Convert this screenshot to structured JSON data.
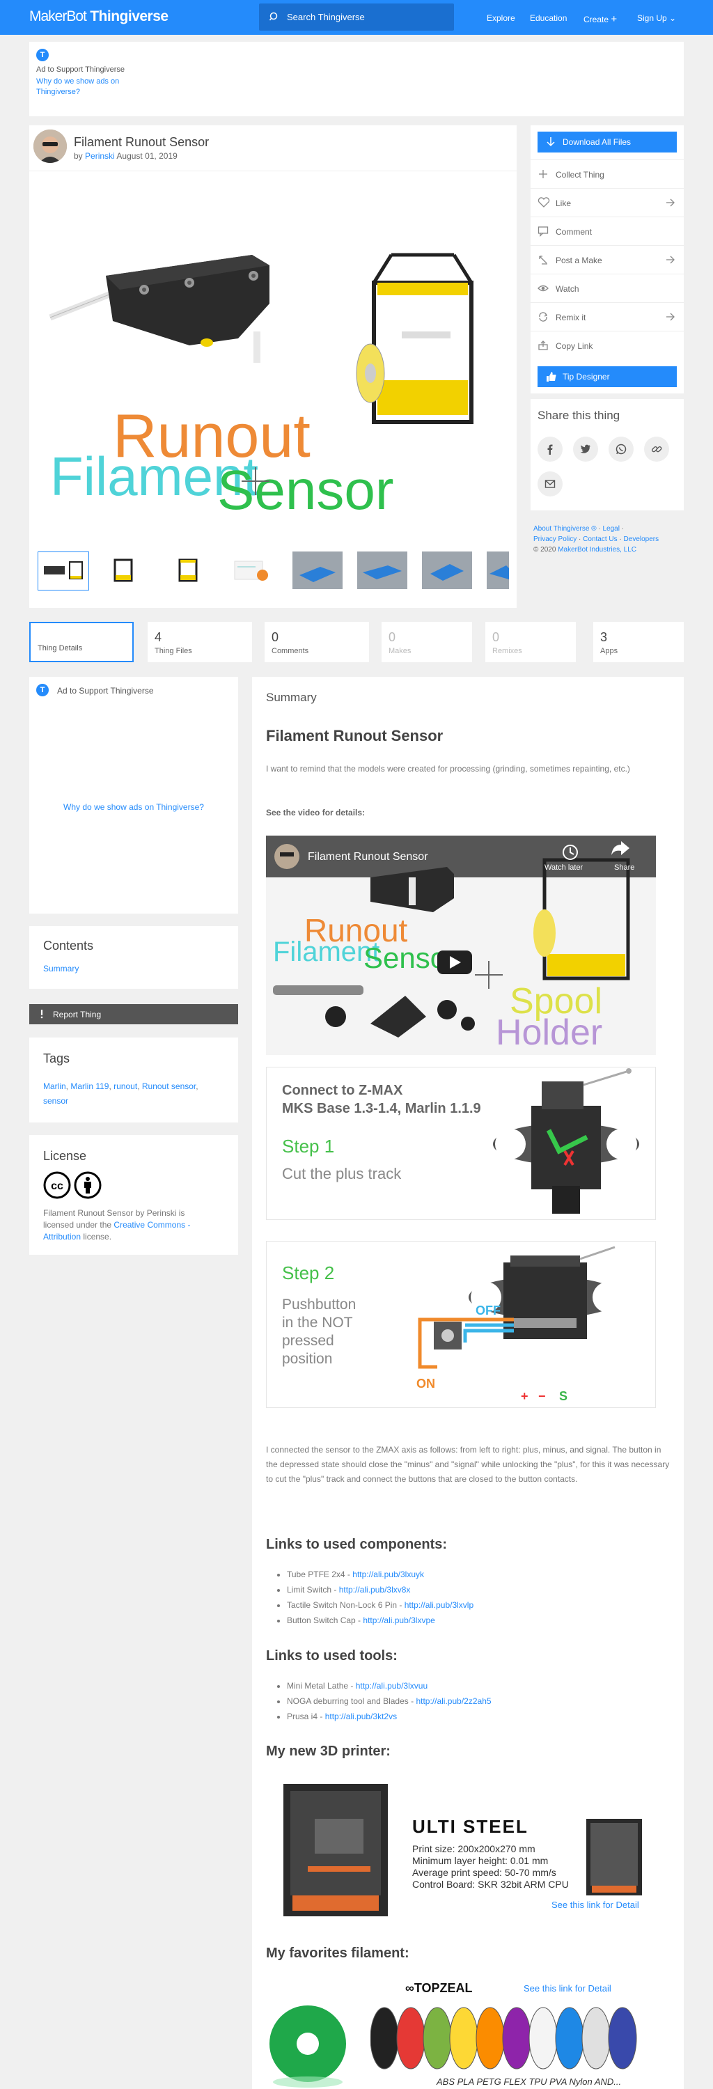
{
  "header": {
    "logo_maker": "MakerBot",
    "logo_thing": "Thingiverse",
    "search_placeholder": "Search Thingiverse",
    "nav": [
      "Explore",
      "Education",
      "Create",
      "Sign Up"
    ],
    "brand_color": "#248bfb"
  },
  "adbar": {
    "badge": "T",
    "support": "Ad to Support Thingiverse",
    "why": "Why do we show ads on Thingiverse?"
  },
  "thing": {
    "title": "Filament Runout Sensor",
    "by": "by",
    "author": "Perinski",
    "date": "August 01, 2019",
    "hero_words": [
      "Runout",
      "Filament",
      "Sensor"
    ],
    "thumb_count": 8
  },
  "actions": {
    "download": "Download All Files",
    "items": [
      {
        "label": "Collect Thing",
        "icon": "plus-icon",
        "arrow": false
      },
      {
        "label": "Like",
        "icon": "heart-icon",
        "arrow": true
      },
      {
        "label": "Comment",
        "icon": "comment-icon",
        "arrow": false
      },
      {
        "label": "Post a Make",
        "icon": "make-icon",
        "arrow": true
      },
      {
        "label": "Watch",
        "icon": "eye-icon",
        "arrow": false
      },
      {
        "label": "Remix it",
        "icon": "remix-icon",
        "arrow": true
      },
      {
        "label": "Copy Link",
        "icon": "share-icon",
        "arrow": false
      }
    ],
    "tip": "Tip Designer"
  },
  "share": {
    "title": "Share this thing",
    "networks": [
      "facebook-icon",
      "twitter-icon",
      "whatsapp-icon",
      "link-icon",
      "email-icon"
    ]
  },
  "footer": {
    "about": "About Thingiverse ®",
    "legal": "Legal",
    "privacy": "Privacy Policy",
    "contact": "Contact Us",
    "developers": "Developers",
    "copyright": "© 2020",
    "company": "MakerBot Industries, LLC"
  },
  "tabs": [
    {
      "num": "",
      "label": "Thing Details",
      "muted": false
    },
    {
      "num": "4",
      "label": "Thing Files",
      "muted": false
    },
    {
      "num": "0",
      "label": "Comments",
      "muted": false
    },
    {
      "num": "0",
      "label": "Makes",
      "muted": true
    },
    {
      "num": "0",
      "label": "Remixes",
      "muted": true
    },
    {
      "num": "3",
      "label": "Apps",
      "muted": false
    }
  ],
  "ad2": {
    "badge": "T",
    "support": "Ad to Support Thingiverse",
    "why": "Why do we show ads on Thingiverse?"
  },
  "contents": {
    "title": "Contents",
    "link": "Summary"
  },
  "report": "Report Thing",
  "tags": {
    "title": "Tags",
    "items": [
      "Marlin",
      "Marlin 119",
      "runout",
      "Runout sensor",
      "sensor"
    ]
  },
  "license": {
    "title": "License",
    "text_a": "Filament Runout Sensor by Perinski is licensed under the",
    "link": "Creative Commons - Attribution",
    "text_b": "license."
  },
  "summary": {
    "section": "Summary",
    "heading": "Filament Runout Sensor",
    "intro": "I want to remind that the models were created for processing (grinding, sometimes repainting, etc.)",
    "video_label": "See the video for details:",
    "video_title": "Filament Runout Sensor",
    "video_watch": "Watch later",
    "video_share": "Share",
    "video_words": [
      "Runout",
      "Filament",
      "Sensor",
      "Spool",
      "Holder"
    ],
    "step1_line1": "Connect to Z-MAX",
    "step1_line2": "MKS Base 1.3-1.4, Marlin 1.1.9",
    "step1_title": "Step 1",
    "step1_desc": "Cut the plus track",
    "step2_title": "Step 2",
    "step2_desc": [
      "Pushbutton",
      "in the NOT",
      "pressed",
      "position"
    ],
    "step2_off": "OFF",
    "step2_on": "ON",
    "step2_signs": [
      "+",
      "−",
      "S"
    ],
    "body": "I connected the sensor to the ZMAX axis as follows: from left to right: plus, minus, and signal. The button in the depressed state should close the \"minus\" and \"signal\" while unlocking the \"plus\", for this it was necessary to cut the \"plus\" track and connect the buttons that are closed to the button contacts.",
    "components_title": "Links to used components:",
    "components": [
      {
        "name": "Tube PTFE 2x4",
        "url": "http://ali.pub/3lxuyk"
      },
      {
        "name": "Limit Switch",
        "url": "http://ali.pub/3lxv8x"
      },
      {
        "name": "Tactile Switch Non-Lock 6 Pin",
        "url": "http://ali.pub/3lxvlp"
      },
      {
        "name": "Button Switch Cap",
        "url": "http://ali.pub/3lxvpe"
      }
    ],
    "tools_title": "Links to used tools:",
    "tools": [
      {
        "name": "Mini Metal Lathe",
        "url": "http://ali.pub/3lxvuu"
      },
      {
        "name": "NOGA deburring tool and Blades",
        "url": "http://ali.pub/2z2ah5"
      },
      {
        "name": "Prusa i4",
        "url": "http://ali.pub/3kt2vs"
      }
    ],
    "printer_title": "My new 3D printer:",
    "printer_name": "ULTI STEEL",
    "printer_specs": [
      "Print size: 200x200x270 mm",
      "Minimum layer height: 0.01 mm",
      "Average print speed: 50-70 mm/s",
      "Control Board: SKR 32bit ARM CPU"
    ],
    "printer_link": "See this link for Detail",
    "filament_title": "My favorites filament:",
    "filament_brand": "TOPZEAL",
    "filament_link": "See this link for Detail",
    "filament_types": "ABS PLA PETG FLEX TPU PVA Nylon AND..."
  }
}
